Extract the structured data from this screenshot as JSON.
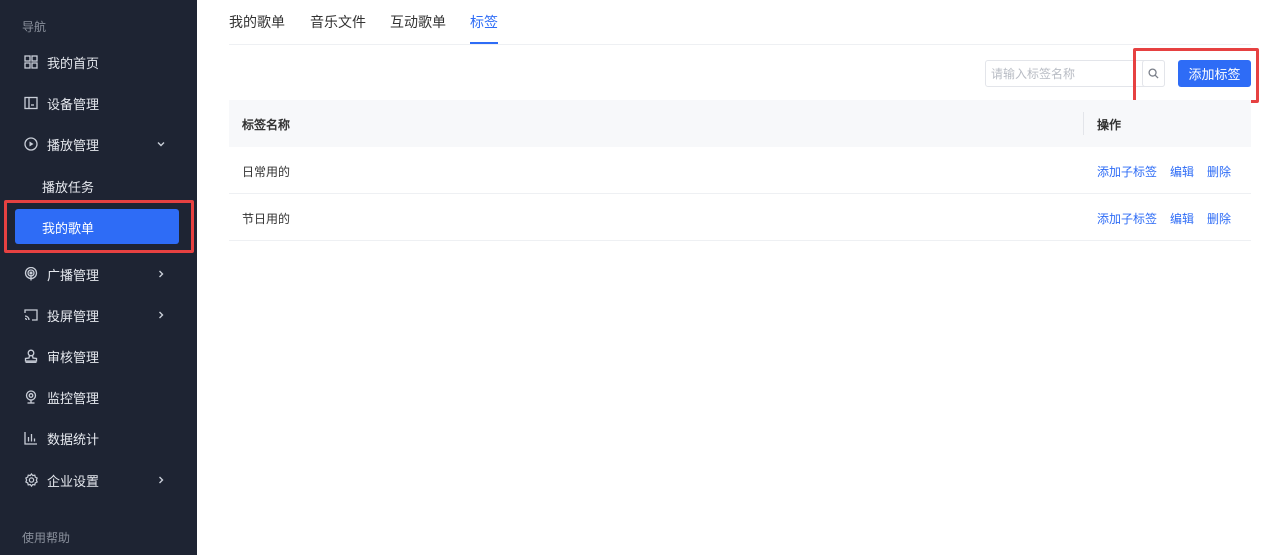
{
  "sidebar": {
    "section_nav": "导航",
    "section_help": "使用帮助",
    "items": [
      {
        "label": "我的首页",
        "icon": "grid-icon"
      },
      {
        "label": "设备管理",
        "icon": "device-icon"
      },
      {
        "label": "播放管理",
        "icon": "play-circle-icon",
        "chevron": "down"
      },
      {
        "label": "广播管理",
        "icon": "broadcast-icon",
        "chevron": "right"
      },
      {
        "label": "投屏管理",
        "icon": "cast-icon",
        "chevron": "right"
      },
      {
        "label": "审核管理",
        "icon": "stamp-icon"
      },
      {
        "label": "监控管理",
        "icon": "camera-icon"
      },
      {
        "label": "数据统计",
        "icon": "bar-chart-icon"
      },
      {
        "label": "企业设置",
        "icon": "gear-icon",
        "chevron": "right"
      }
    ],
    "sub_items": [
      {
        "label": "播放任务"
      },
      {
        "label": "我的歌单",
        "active": true
      }
    ]
  },
  "tabs": [
    {
      "label": "我的歌单"
    },
    {
      "label": "音乐文件"
    },
    {
      "label": "互动歌单"
    },
    {
      "label": "标签",
      "active": true
    }
  ],
  "toolbar": {
    "search_placeholder": "请输入标签名称",
    "add_label": "添加标签"
  },
  "table": {
    "columns": [
      "标签名称",
      "操作"
    ],
    "rows": [
      {
        "name": "日常用的",
        "actions": [
          "添加子标签",
          "编辑",
          "删除"
        ]
      },
      {
        "name": "节日用的",
        "actions": [
          "添加子标签",
          "编辑",
          "删除"
        ]
      }
    ]
  },
  "colors": {
    "sidebar_bg": "#1e2433",
    "accent": "#2e6cf6",
    "highlight": "#e64141"
  }
}
